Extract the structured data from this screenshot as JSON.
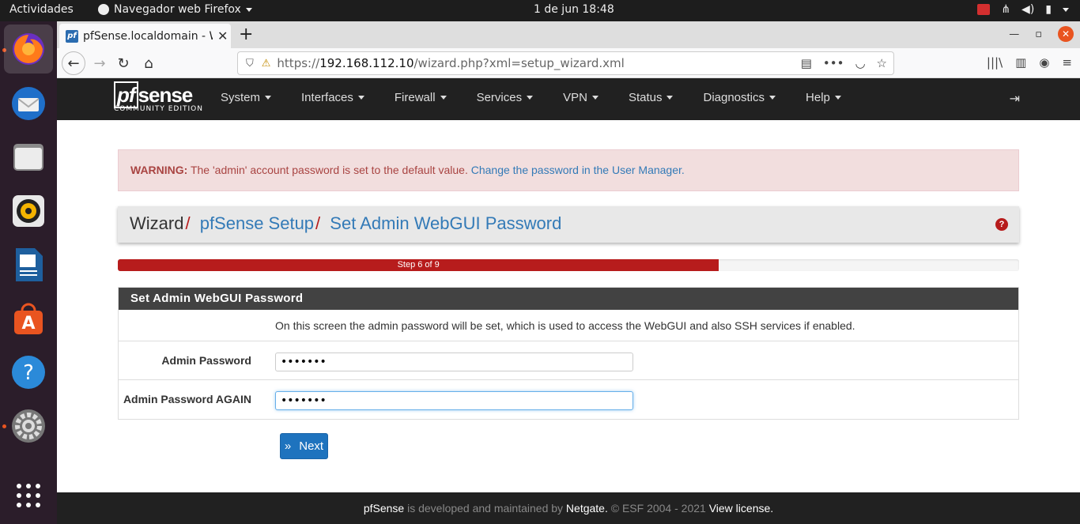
{
  "desktop": {
    "activities": "Actividades",
    "app_menu": "Navegador web Firefox",
    "clock": "1 de jun  18:48"
  },
  "browser": {
    "tab_title": "pfSense.localdomain - W",
    "url_prefix": "https://",
    "url_host": "192.168.112.10",
    "url_path": "/wizard.php?xml=setup_wizard.xml"
  },
  "pfsense": {
    "logo_main": "sense",
    "logo_pf": "pf",
    "logo_sub": "COMMUNITY EDITION",
    "menu": [
      "System",
      "Interfaces",
      "Firewall",
      "Services",
      "VPN",
      "Status",
      "Diagnostics",
      "Help"
    ],
    "warning": {
      "label": "WARNING:",
      "text": " The 'admin' account password is set to the default value. ",
      "link": "Change the password in the User Manager."
    },
    "breadcrumb": {
      "root": "Wizard",
      "sep": "/",
      "item1": "pfSense Setup",
      "item2": "Set Admin WebGUI Password"
    },
    "progress": {
      "label": "Step 6 of 9",
      "value": 0.667,
      "color": "#b71c1c"
    },
    "panel": {
      "title": "Set Admin WebGUI Password",
      "info": "On this screen the admin password will be set, which is used to access the WebGUI and also SSH services if enabled.",
      "fields": [
        {
          "label": "Admin Password",
          "value": "•••••••"
        },
        {
          "label": "Admin Password AGAIN",
          "value": "•••••••"
        }
      ]
    },
    "next_label": "Next",
    "footer": {
      "brand": "pfSense",
      "mid": " is developed and maintained by ",
      "company": "Netgate.",
      "copy": " © ESF 2004 - 2021 ",
      "license": "View license."
    }
  }
}
